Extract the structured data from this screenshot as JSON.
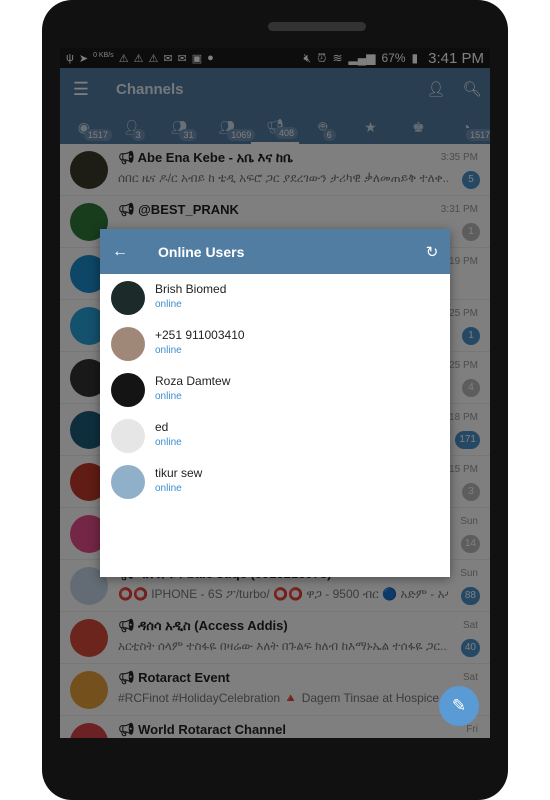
{
  "status_bar": {
    "battery": "67%",
    "time": "3:41 PM",
    "data_rate": "0 KB/s"
  },
  "toolbar": {
    "title": "Channels"
  },
  "tabs": [
    {
      "icon": "all-chats-icon",
      "count": "1517"
    },
    {
      "icon": "user-icon",
      "count": "3"
    },
    {
      "icon": "group-icon",
      "count": "31"
    },
    {
      "icon": "supergroup-icon",
      "count": "1069"
    },
    {
      "icon": "megaphone-icon",
      "count": "408"
    },
    {
      "icon": "bot-icon",
      "count": "6"
    },
    {
      "icon": "star-icon",
      "count": ""
    },
    {
      "icon": "admin-icon",
      "count": ""
    },
    {
      "icon": "unread-icon",
      "count": "1517"
    }
  ],
  "chats": [
    {
      "name": "Abe Ena Kebe - አቤ እና ከቤ",
      "time": "3:35 PM",
      "msg": "ሰበር ዜና ዶ/ር አብይ ከ ቴዲ አፍሮ ጋር ያደረገውን ታሪካዊ ቃለመጠይቅ ተለቀ...",
      "badge": "5",
      "badge_color": "#4a90c8",
      "avatar_color": "#3a3a2a"
    },
    {
      "name": "@BEST_PRANK",
      "time": "3:31 PM",
      "msg": "",
      "badge": "1",
      "badge_color": "#bbbbbb",
      "avatar_color": "#2f7a3a"
    },
    {
      "name": "",
      "time": "19 PM",
      "msg": "",
      "badge": "",
      "badge_color": "#bbbbbb",
      "avatar_color": "#1a8ccf"
    },
    {
      "name": "",
      "time": "25 PM",
      "msg": "",
      "badge": "1",
      "badge_color": "#4a90c8",
      "avatar_color": "#27a3d8"
    },
    {
      "name": "",
      "time": "25 PM",
      "msg": "",
      "badge": "4",
      "badge_color": "#bbbbbb",
      "avatar_color": "#333333"
    },
    {
      "name": "",
      "time": "18 PM",
      "msg": "",
      "badge": "171",
      "badge_color": "#4a90c8",
      "avatar_color": "#1f5c7a"
    },
    {
      "name": "",
      "time": "15 PM",
      "msg": "",
      "badge": "3",
      "badge_color": "#bbbbbb",
      "avatar_color": "#c0392b"
    },
    {
      "name": "",
      "time": "Sun",
      "msg": "",
      "badge": "14",
      "badge_color": "#bbbbbb",
      "avatar_color": "#e74c8b"
    },
    {
      "name": "ባለ ሱቁ / bale suqe (0913213973)",
      "time": "Sun",
      "msg": "⭕⭕ IPHONE - 6S ፖ/turbo/ ⭕⭕ ዋጋ - 9500 ብር 🔵 አድም - አዲ...",
      "badge": "88",
      "badge_color": "#4a90c8",
      "avatar_color": "#c7d7e8"
    },
    {
      "name": "ዳሰሳ አዲስ (Access Addis)",
      "time": "Sat",
      "msg": "አርቲስት ሰላም ተስፋዬ በዛሬው እለት በጉልፍ ክለብ ከእማኑኤል ተሰፋዬ ጋር...",
      "badge": "40",
      "badge_color": "#4a90c8",
      "avatar_color": "#d84a3a"
    },
    {
      "name": "Rotaract Event",
      "time": "Sat",
      "msg": "#RCFinot #HolidayCelebration 🔺 Dagem Tinsae at Hospice...",
      "badge": "",
      "badge_color": "#bbbbbb",
      "avatar_color": "#e8a13a"
    },
    {
      "name": "World Rotaract Channel",
      "time": "Fri",
      "msg": "",
      "badge": "",
      "badge_color": "#bbbbbb",
      "avatar_color": "#d9434a"
    }
  ],
  "dialog": {
    "title": "Online Users",
    "users": [
      {
        "name": "Brish Biomed",
        "status": "online",
        "avatar_color": "#1c2a2a"
      },
      {
        "name": "+251 911003410",
        "status": "online",
        "avatar_color": "#a08878"
      },
      {
        "name": "Roza Damtew",
        "status": "online",
        "avatar_color": "#141414"
      },
      {
        "name": "ed",
        "status": "online",
        "avatar_color": "#e6e6e6"
      },
      {
        "name": "tikur sew",
        "status": "online",
        "avatar_color": "#8fb0c8"
      }
    ]
  }
}
